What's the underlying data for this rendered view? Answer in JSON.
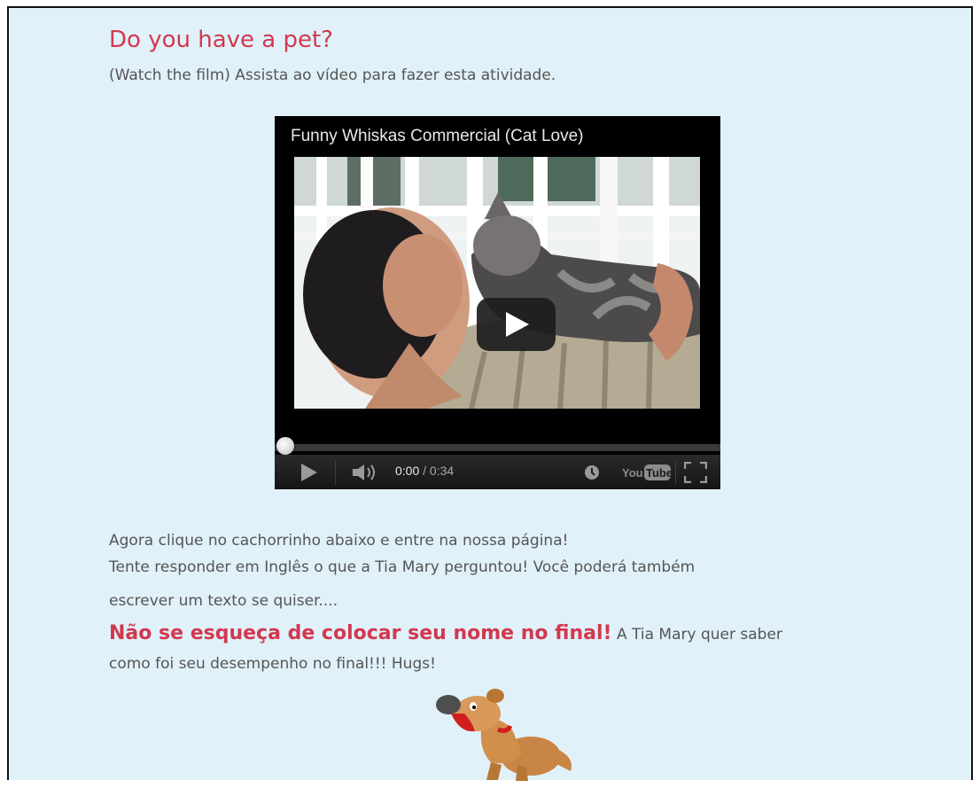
{
  "post": {
    "title": "Do you have a pet?",
    "subtitle": "(Watch the film) Assista ao vídeo para fazer esta atividade."
  },
  "video": {
    "title": "Funny Whiskas Commercial (Cat Love)",
    "time_current": "0:00",
    "time_separator": "/",
    "time_total": "0:34",
    "progress": 0,
    "youtube_you": "You",
    "youtube_tube": "Tube"
  },
  "body": {
    "line1": "Agora clique no cachorrinho abaixo e entre na nossa página!",
    "line2": "Tente responder em Inglês o que a Tia Mary perguntou! Você poderá também",
    "line3": "escrever um texto se quiser....",
    "warning": "Não se esqueça de colocar seu nome no final!",
    "line4_rest": " A Tia Mary quer saber",
    "line5": "como foi seu desempenho no final!!! Hugs!"
  },
  "colors": {
    "page_bg": "#e1f1f9",
    "accent": "#d2384f",
    "text": "#555555"
  },
  "icons": [
    "play-icon",
    "volume-icon",
    "watch-later-icon",
    "youtube-logo",
    "fullscreen-icon",
    "dog-icon"
  ]
}
